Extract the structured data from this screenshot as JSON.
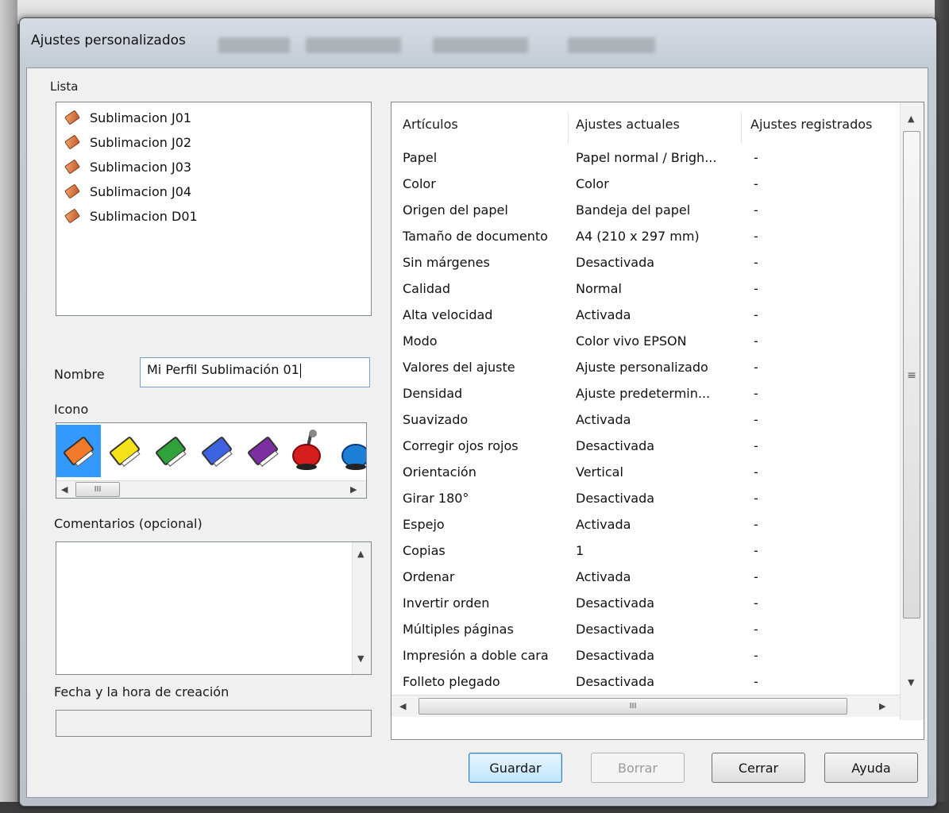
{
  "window": {
    "title": "Ajustes personalizados"
  },
  "labels": {
    "lista": "Lista",
    "nombre": "Nombre",
    "icono": "Icono",
    "comentarios": "Comentarios (opcional)",
    "fecha": "Fecha y la hora de creación"
  },
  "lista": [
    "Sublimacion J01",
    "Sublimacion J02",
    "Sublimacion J03",
    "Sublimacion J04",
    "Sublimacion D01"
  ],
  "nombre_value": "Mi Perfil Sublimación 01",
  "icons": [
    {
      "name": "orange-book-icon",
      "color": "#f07a2a",
      "selected": true
    },
    {
      "name": "yellow-book-icon",
      "color": "#f4e21a",
      "selected": false
    },
    {
      "name": "green-book-icon",
      "color": "#2fa33a",
      "selected": false
    },
    {
      "name": "blue-book-icon",
      "color": "#3e63e0",
      "selected": false
    },
    {
      "name": "purple-book-icon",
      "color": "#7b2fa0",
      "selected": false
    },
    {
      "name": "red-stamp-icon",
      "color": "#d61e1e",
      "selected": false
    },
    {
      "name": "blue-stamp-icon",
      "color": "#1e7fd6",
      "selected": false
    }
  ],
  "table": {
    "headers": [
      "Artículos",
      "Ajustes actuales",
      "Ajustes registrados"
    ],
    "rows": [
      [
        "Papel",
        "Papel normal / Brigh...",
        "-"
      ],
      [
        "Color",
        "Color",
        "-"
      ],
      [
        "Origen del papel",
        "Bandeja del papel",
        "-"
      ],
      [
        "Tamaño de documento",
        "A4 (210 x 297 mm)",
        "-"
      ],
      [
        "Sin márgenes",
        "Desactivada",
        "-"
      ],
      [
        "Calidad",
        "Normal",
        "-"
      ],
      [
        "Alta velocidad",
        "Activada",
        "-"
      ],
      [
        "Modo",
        "Color vivo EPSON",
        "-"
      ],
      [
        "Valores del ajuste",
        "Ajuste personalizado",
        "-"
      ],
      [
        "Densidad",
        "Ajuste predetermin...",
        "-"
      ],
      [
        "Suavizado",
        "Activada",
        "-"
      ],
      [
        "Corregir ojos rojos",
        "Desactivada",
        "-"
      ],
      [
        "Orientación",
        "Vertical",
        "-"
      ],
      [
        "Girar 180°",
        "Desactivada",
        "-"
      ],
      [
        "Espejo",
        "Activada",
        "-"
      ],
      [
        "Copias",
        "1",
        "-"
      ],
      [
        "Ordenar",
        "Activada",
        "-"
      ],
      [
        "Invertir orden",
        "Desactivada",
        "-"
      ],
      [
        "Múltiples páginas",
        "Desactivada",
        "-"
      ],
      [
        "Impresión a doble cara",
        "Desactivada",
        "-"
      ],
      [
        "Folleto plegado",
        "Desactivada",
        "-"
      ]
    ]
  },
  "buttons": {
    "guardar": "Guardar",
    "borrar": "Borrar",
    "cerrar": "Cerrar",
    "ayuda": "Ayuda"
  },
  "scroll_glyphs": {
    "thumb": "III",
    "vthumb": "≡",
    "up": "▲",
    "down": "▼",
    "left": "◀",
    "right": "▶"
  },
  "colors": {
    "selection": "#3399ff",
    "default_button": "#bee6fd"
  }
}
